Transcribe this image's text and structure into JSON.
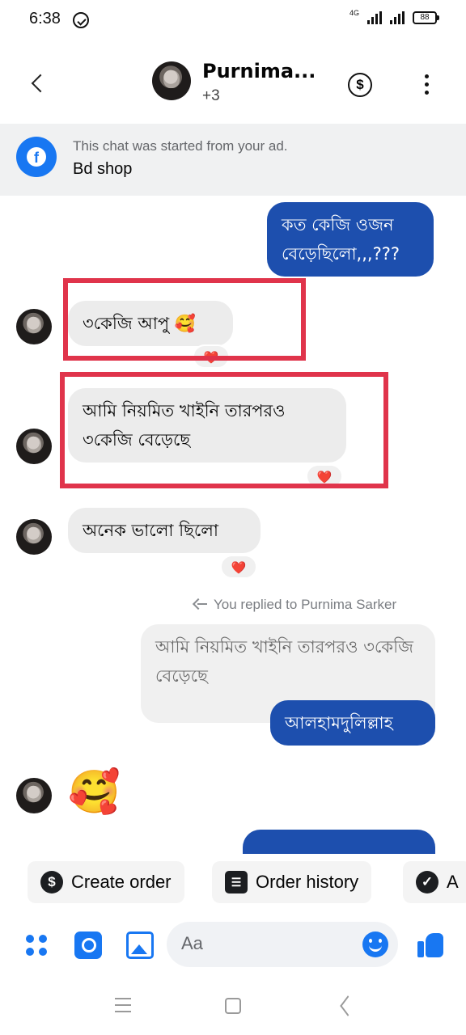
{
  "status_bar": {
    "time": "6:38",
    "network": "4G",
    "battery": "88"
  },
  "header": {
    "name": "Purnima...",
    "subtitle": "+3",
    "dollar_symbol": "$"
  },
  "ad_banner": {
    "text": "This chat was started from your ad.",
    "shop": "Bd shop",
    "logo_letter": "f"
  },
  "messages": [
    {
      "side": "out",
      "text": "কত কেজি ওজন বেড়েছিলো,,,???"
    },
    {
      "side": "in",
      "text": "৩কেজি আপু 🥰",
      "reaction": "❤️"
    },
    {
      "side": "in",
      "text": "আমি নিয়মিত খাইনি তারপরও ৩কেজি বেড়েছে",
      "reaction": "❤️"
    },
    {
      "side": "in",
      "text": "অনেক ভালো ছিলো",
      "reaction": "❤️"
    },
    {
      "side": "out",
      "replied_label": "You replied to Purnima Sarker",
      "quoted": "আমি নিয়মিত খাইনি তারপরও ৩কেজি বেড়েছে",
      "text": "আলহামদুলিল্লাহ"
    },
    {
      "side": "in",
      "emoji": "🥰"
    }
  ],
  "quick_actions": [
    {
      "label": "Create order",
      "icon": "dollar-icon",
      "glyph": "$"
    },
    {
      "label": "Order history",
      "icon": "receipt-icon",
      "glyph": "☰"
    },
    {
      "label": "A",
      "icon": "check-icon",
      "glyph": "✓"
    }
  ],
  "composer": {
    "placeholder": "Aa"
  },
  "colors": {
    "accent": "#1877f2",
    "outgoing_bubble": "#1d4fae",
    "highlight": "#e0344b"
  }
}
